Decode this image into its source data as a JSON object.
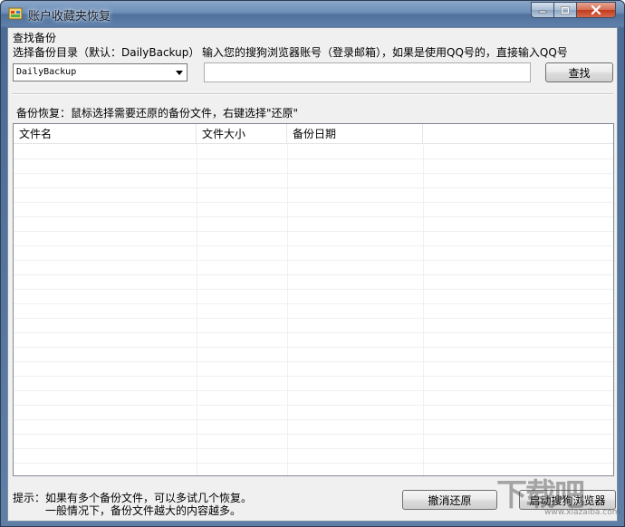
{
  "window": {
    "title": "账户收藏夹恢复"
  },
  "search_group": {
    "label": "查找备份",
    "dir_label": "选择备份目录（默认：DailyBackup）",
    "dir_selected": "DailyBackup",
    "account_label": "输入您的搜狗浏览器账号（登录邮箱），如果是使用QQ号的，直接输入QQ号",
    "account_value": "",
    "search_button": "查找"
  },
  "restore_group": {
    "label": "备份恢复：鼠标选择需要还原的备份文件，右键选择\"还原\"",
    "columns": [
      "文件名",
      "文件大小",
      "备份日期",
      ""
    ],
    "rows": []
  },
  "footer": {
    "tip_line1": "提示：如果有多个备份文件，可以多试几个恢复。",
    "tip_line2": "一般情况下，备份文件越大的内容越多。",
    "undo_button": "撤消还原",
    "launch_button": "启动搜狗浏览器"
  },
  "watermark": {
    "text": "下载吧",
    "url": "www.xiazaiba.com"
  },
  "colors": {
    "titlebar": "#5e80aa",
    "client_bg": "#f0f0f0",
    "close_button": "#c13a1c"
  }
}
